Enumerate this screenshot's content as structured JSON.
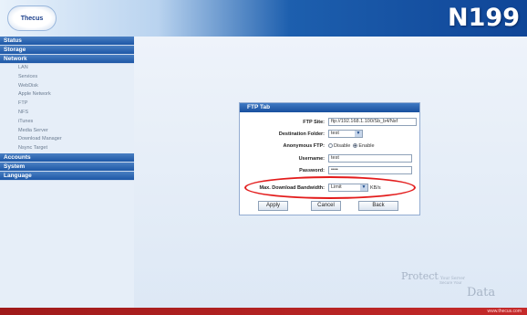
{
  "header": {
    "logo_text": "Thecus",
    "model": "N199"
  },
  "sidebar": {
    "sections": [
      {
        "label": "Status"
      },
      {
        "label": "Storage"
      },
      {
        "label": "Network",
        "items": [
          "LAN",
          "Services",
          "WebDisk",
          "Apple Network",
          "FTP",
          "NFS",
          "iTunes",
          "Media Server",
          "Download Manager",
          "Nsync Target"
        ]
      },
      {
        "label": "Accounts"
      },
      {
        "label": "System"
      },
      {
        "label": "Language"
      }
    ]
  },
  "ftp_panel": {
    "title": "FTP Tab",
    "fields": {
      "ftp_site_label": "FTP Site:",
      "ftp_site_value": "ftp://192.168.1.100/Sb_b4/Nsf",
      "destination_folder_label": "Destination Folder:",
      "destination_folder_value": "test",
      "anonymous_ftp_label": "Anonymous FTP:",
      "anon_option_off": "Disable",
      "anon_option_on": "Enable",
      "username_label": "Username:",
      "username_value": "test",
      "password_label": "Password:",
      "password_value": "••••",
      "max_bandwidth_label": "Max. Download Bandwidth:",
      "max_bandwidth_value": "Limit",
      "max_bandwidth_unit": "KB/s"
    },
    "buttons": {
      "apply": "Apply",
      "cancel": "Cancel",
      "back": "Back"
    }
  },
  "branding": {
    "protect_big": "Protect",
    "protect_line1": "Your Server",
    "protect_line2": "Secure Your",
    "data": "Data"
  },
  "footer": {
    "url": "www.thecus.com"
  },
  "colors": {
    "accent": "#1d57a6",
    "highlight": "#e31c1c",
    "footer": "#b52222"
  }
}
